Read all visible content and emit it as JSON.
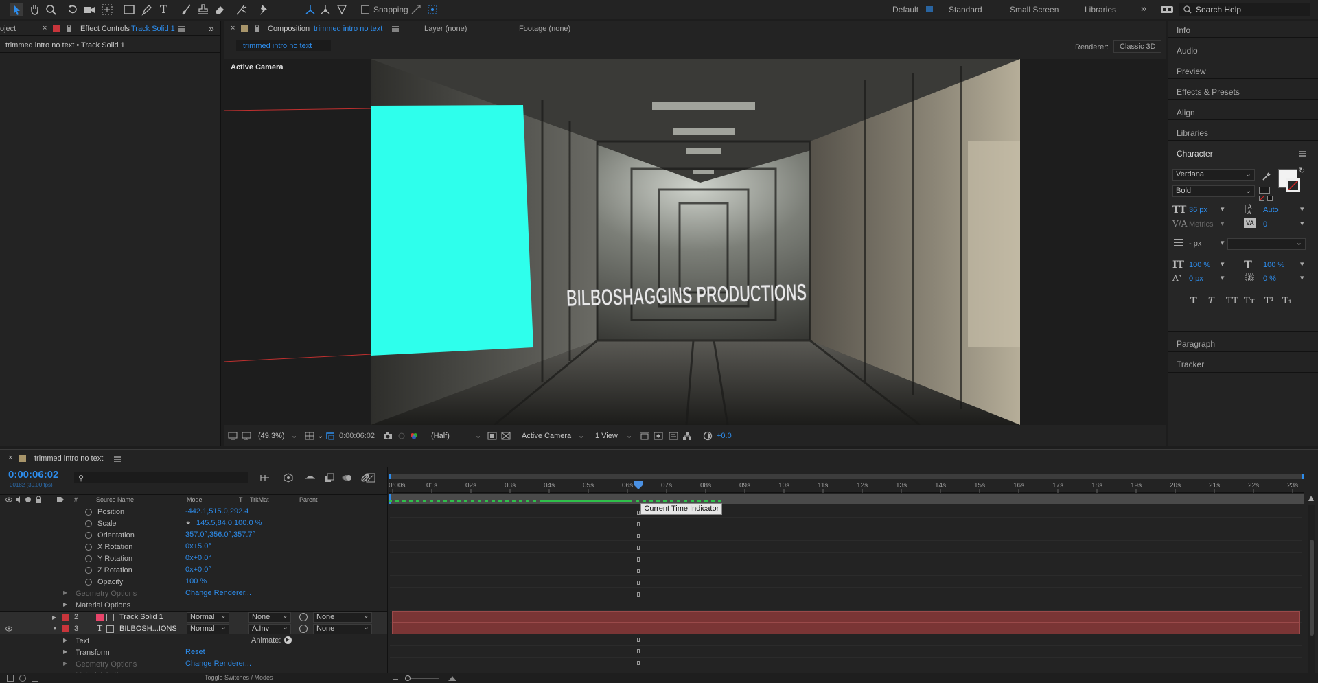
{
  "toolbar": {
    "snapping_label": "Snapping",
    "workspaces": [
      "Default",
      "Standard",
      "Small Screen",
      "Libraries"
    ],
    "search_placeholder": "Search Help"
  },
  "left_panel": {
    "tab_project": "oject",
    "tab_effect_controls": "Effect Controls",
    "tab_effect_target": "Track Solid 1",
    "breadcrumb": "trimmed intro no text • Track Solid 1"
  },
  "comp_panel": {
    "tab_prefix": "Composition",
    "tab_name": "trimmed intro no text",
    "layer_tab": "Layer (none)",
    "footage_tab": "Footage (none)",
    "subtab": "trimmed intro no text",
    "renderer_label": "Renderer:",
    "renderer_value": "Classic 3D",
    "active_camera": "Active Camera",
    "overlay_text": "BILBOSHAGGINS PRODUCTIONS",
    "footer": {
      "zoom": "(49.3%)",
      "timecode": "0:00:06:02",
      "resolution": "(Half)",
      "view": "Active Camera",
      "views": "1 View",
      "exposure": "+0.0"
    },
    "solid_color": "#2effec"
  },
  "right_panel": {
    "items_top": [
      "Info",
      "Audio",
      "Preview",
      "Effects & Presets",
      "Align",
      "Libraries"
    ],
    "character": {
      "title": "Character",
      "font": "Verdana",
      "style": "Bold",
      "size": "36 px",
      "leading": "Auto",
      "kerning": "Metrics",
      "tracking": "0",
      "stroke": "- px",
      "vscale": "100 %",
      "hscale": "100 %",
      "baseline": "0 px",
      "tsume": "0 %",
      "style_buttons": [
        "T",
        "T",
        "TT",
        "Tт",
        "T¹",
        "T₁"
      ]
    },
    "items_bottom": [
      "Paragraph",
      "Tracker"
    ]
  },
  "timeline": {
    "comp_tab": "trimmed intro no text",
    "timecode": "0:00:06:02",
    "frames": "00182 (30.00 fps)",
    "columns": {
      "hash": "#",
      "source": "Source Name",
      "mode": "Mode",
      "t": "T",
      "trkmat": "TrkMat",
      "parent": "Parent"
    },
    "ruler": [
      "0:00s",
      "01s",
      "02s",
      "03s",
      "04s",
      "05s",
      "06s",
      "07s",
      "08s",
      "09s",
      "10s",
      "11s",
      "12s",
      "13s",
      "14s",
      "15s",
      "16s",
      "17s",
      "18s",
      "19s",
      "20s",
      "21s",
      "22s",
      "23s"
    ],
    "tooltip": "Current Time Indicator",
    "props": [
      {
        "name": "Position",
        "value": "-442.1,515.0,292.4"
      },
      {
        "name": "Scale",
        "value": "145.5,84.0,100.0 %"
      },
      {
        "name": "Orientation",
        "value": "357.0°,356.0°,357.7°"
      },
      {
        "name": "X Rotation",
        "value": "0x+5.0°"
      },
      {
        "name": "Y Rotation",
        "value": "0x+0.0°"
      },
      {
        "name": "Z Rotation",
        "value": "0x+0.0°"
      },
      {
        "name": "Opacity",
        "value": "100 %"
      }
    ],
    "geometry_options": "Geometry Options",
    "change_renderer": "Change Renderer...",
    "material_options": "Material Options",
    "layers": [
      {
        "num": "2",
        "name": "Track Solid 1",
        "mode": "Normal",
        "trkmat": "None",
        "parent": "None",
        "label_color": "#e8446a"
      },
      {
        "num": "3",
        "name": "BILBOSH...IONS",
        "mode": "Normal",
        "trkmat": "A.Inv",
        "parent": "None",
        "type": "T"
      }
    ],
    "animate_label": "Animate:",
    "text_group": "Text",
    "transform_group": "Transform",
    "reset_label": "Reset",
    "geometry_options_2": "Geometry Options",
    "change_renderer_2": "Change Renderer...",
    "material_options_2": "Material Options",
    "bottom_label": "Toggle Switches / Modes",
    "layer_bar_color": "#7a3535",
    "cti_fraction": 0.262
  }
}
